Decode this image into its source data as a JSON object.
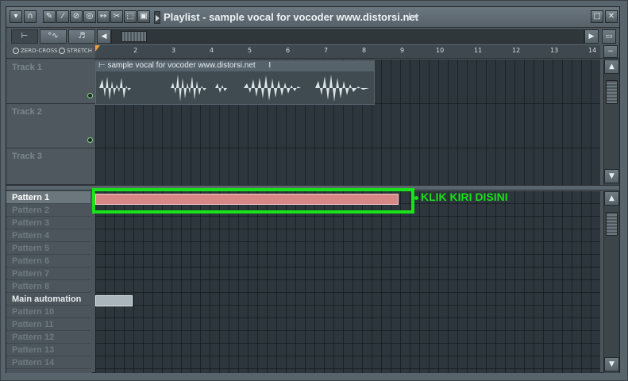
{
  "window": {
    "title": "Playlist - sample vocal for vocoder www.distorsi.net",
    "title_suffix": "I ▾"
  },
  "toolbar": {
    "icons": [
      "menu-arrow-icon",
      "magnet-icon",
      "pencil-icon",
      "brush-icon",
      "delete-icon",
      "mute-icon",
      "slip-icon",
      "slice-icon",
      "select-icon",
      "zoom-icon"
    ],
    "window_buttons": [
      "□",
      "✕"
    ]
  },
  "tabs": [
    "⊢",
    "°∿",
    "♬"
  ],
  "options": {
    "zero_cross": "ZERO-CROSS",
    "stretch": "STRETCH"
  },
  "ruler": {
    "ticks": [
      "2",
      "3",
      "4",
      "5",
      "6",
      "7",
      "8",
      "9",
      "10",
      "11",
      "12",
      "13",
      "14"
    ]
  },
  "tracks": [
    {
      "name": "Track 1"
    },
    {
      "name": "Track 2"
    },
    {
      "name": "Track 3"
    }
  ],
  "clip": {
    "title": "sample vocal for vocoder www.distorsi.net",
    "marker": "I"
  },
  "patterns": [
    {
      "name": "Pattern 1"
    },
    {
      "name": "Pattern 2"
    },
    {
      "name": "Pattern 3"
    },
    {
      "name": "Pattern 4"
    },
    {
      "name": "Pattern 5"
    },
    {
      "name": "Pattern 6"
    },
    {
      "name": "Pattern 7"
    },
    {
      "name": "Pattern 8"
    },
    {
      "name": "Main automation"
    },
    {
      "name": "Pattern 10"
    },
    {
      "name": "Pattern 11"
    },
    {
      "name": "Pattern 12"
    },
    {
      "name": "Pattern 13"
    },
    {
      "name": "Pattern 14"
    }
  ],
  "annotation": {
    "text": "KLIK KIRI DISINI",
    "color": "#19e019"
  },
  "colors": {
    "pattern_block": "#d88787",
    "automation_block": "#aab6bc",
    "highlight": "#18e318"
  }
}
